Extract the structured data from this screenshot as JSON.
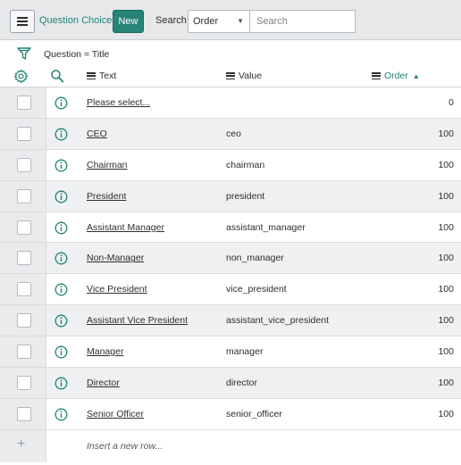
{
  "toolbar": {
    "title": "Question Choices",
    "new_label": "New",
    "search_label": "Search",
    "search_field_selected": "Order",
    "search_placeholder": "Search"
  },
  "breadcrumb": {
    "text": "Question = Title"
  },
  "columns": {
    "text": "Text",
    "value": "Value",
    "order": "Order",
    "order_sort": "ascending"
  },
  "rows": [
    {
      "text": "Please select...",
      "value": "",
      "order": "0"
    },
    {
      "text": "CEO",
      "value": "ceo",
      "order": "100"
    },
    {
      "text": "Chairman",
      "value": "chairman",
      "order": "100"
    },
    {
      "text": "President",
      "value": "president",
      "order": "100"
    },
    {
      "text": "Assistant Manager",
      "value": "assistant_manager",
      "order": "100"
    },
    {
      "text": "Non-Manager",
      "value": "non_manager",
      "order": "100"
    },
    {
      "text": "Vice President",
      "value": "vice_president",
      "order": "100"
    },
    {
      "text": "Assistant Vice President",
      "value": "assistant_vice_president",
      "order": "100"
    },
    {
      "text": "Manager",
      "value": "manager",
      "order": "100"
    },
    {
      "text": "Director",
      "value": "director",
      "order": "100"
    },
    {
      "text": "Senior Officer",
      "value": "senior_officer",
      "order": "100"
    }
  ],
  "insert_row": {
    "label": "Insert a new row..."
  },
  "colors": {
    "accent": "#278476",
    "header_bg": "#e6e8ea",
    "alt_row_bg": "#eef0f1"
  },
  "icons": [
    "menu-icon",
    "filter-icon",
    "gear-icon",
    "search-icon",
    "info-icon",
    "plus-icon",
    "sort-up-icon"
  ]
}
